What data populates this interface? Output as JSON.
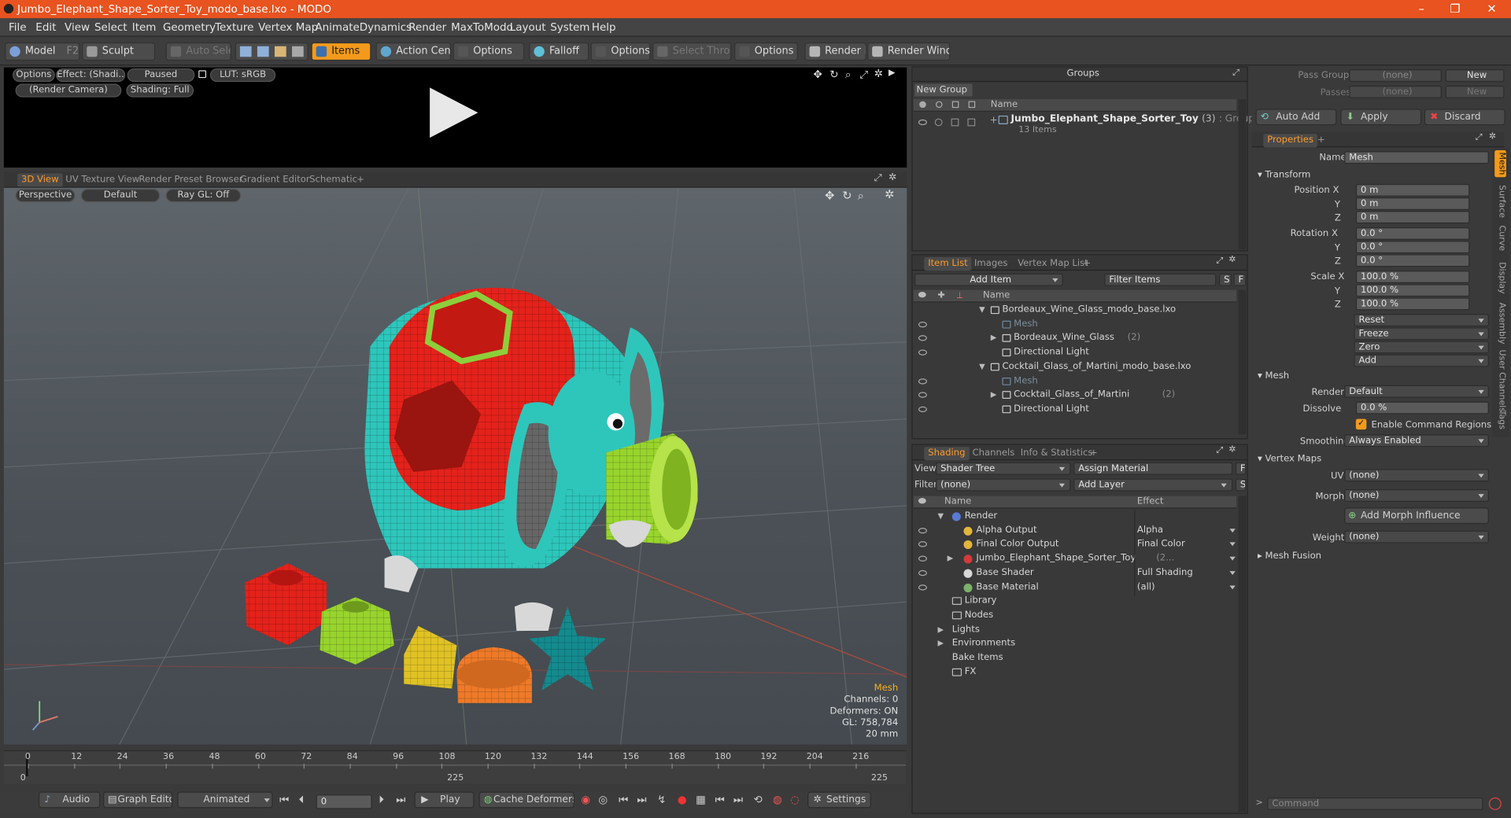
{
  "window": {
    "title": "Jumbo_Elephant_Shape_Sorter_Toy_modo_base.lxo - MODO",
    "controls": [
      "–",
      "❐",
      "✕"
    ]
  },
  "menu": [
    "File",
    "Edit",
    "View",
    "Select",
    "Item",
    "Geometry",
    "Texture",
    "Vertex Map",
    "Animate",
    "Dynamics",
    "Render",
    "MaxToModo",
    "Layout",
    "System",
    "Help"
  ],
  "toolbar": {
    "model": "Model",
    "model_key": "F2",
    "sculpt": "Sculpt",
    "auto_select": "Auto Select",
    "items": "Items",
    "action_center": "Action Center",
    "options1": "Options",
    "falloff": "Falloff",
    "options2": "Options",
    "select_through": "Select Through",
    "options3": "Options",
    "render": "Render",
    "render_key": "F9",
    "render_window": "Render Window"
  },
  "preview": {
    "options": "Options",
    "effect": "Effect: (Shadi...",
    "paused": "Paused",
    "lut": "LUT: sRGB",
    "camera": "(Render Camera)",
    "shading": "Shading: Full"
  },
  "viewport_tabs": [
    "3D View",
    "UV Texture View",
    "Render Preset Browser",
    "Gradient Editor",
    "Schematic",
    "+"
  ],
  "viewport": {
    "perspective": "Perspective",
    "default": "Default",
    "raygl": "Ray GL: Off",
    "info": [
      "Mesh",
      "Channels: 0",
      "Deformers: ON",
      "GL: 758,784",
      "20 mm"
    ]
  },
  "timeline": {
    "ticks": [
      "0",
      "12",
      "24",
      "36",
      "48",
      "60",
      "72",
      "84",
      "96",
      "108",
      "120",
      "132",
      "144",
      "156",
      "168",
      "180",
      "192",
      "204",
      "216"
    ],
    "end": "225",
    "start": "0"
  },
  "bottom": {
    "audio": "Audio",
    "graph_editor": "Graph Editor",
    "animated": "Animated",
    "frame": "0",
    "play": "Play",
    "cache": "Cache Deformers",
    "settings": "Settings"
  },
  "groups": {
    "title": "Groups",
    "new_group": "New Group",
    "col_name": "Name",
    "item": "Jumbo_Elephant_Shape_Sorter_Toy",
    "item_count": "(3)",
    "item_type": ": Group",
    "sub": "13 Items"
  },
  "itemlist": {
    "tabs": [
      "Item List",
      "Images",
      "Vertex Map List",
      "+"
    ],
    "add_item": "Add Item",
    "filter": "Filter Items",
    "s": "S",
    "f": "F",
    "col_name": "Name",
    "rows": [
      {
        "label": "Bordeaux_Wine_Glass_modo_base.lxo",
        "indent": 0
      },
      {
        "label": "Mesh",
        "indent": 1,
        "dim": true
      },
      {
        "label": "Bordeaux_Wine_Glass",
        "suffix": "(2)",
        "indent": 1
      },
      {
        "label": "Directional Light",
        "indent": 1
      },
      {
        "label": "Cocktail_Glass_of_Martini_modo_base.lxo",
        "indent": 0
      },
      {
        "label": "Mesh",
        "indent": 1,
        "dim": true
      },
      {
        "label": "Cocktail_Glass_of_Martini",
        "suffix": "(2)",
        "indent": 1
      },
      {
        "label": "Directional Light",
        "indent": 1
      }
    ]
  },
  "shading": {
    "tabs": [
      "Shading",
      "Channels",
      "Info & Statistics",
      "+"
    ],
    "view_label": "View",
    "view": "Shader Tree",
    "assign": "Assign Material",
    "filter_label": "Filter",
    "filter": "(none)",
    "add_layer": "Add Layer",
    "col_name": "Name",
    "col_effect": "Effect",
    "rows": [
      {
        "label": "Render",
        "effect": "",
        "indent": 0
      },
      {
        "label": "Alpha Output",
        "effect": "Alpha",
        "indent": 1
      },
      {
        "label": "Final Color Output",
        "effect": "Final Color",
        "indent": 1
      },
      {
        "label": "Jumbo_Elephant_Shape_Sorter_Toy",
        "suffix": "(2...",
        "effect": "",
        "indent": 1
      },
      {
        "label": "Base Shader",
        "effect": "Full Shading",
        "indent": 1
      },
      {
        "label": "Base Material",
        "effect": "(all)",
        "indent": 1
      },
      {
        "label": "Library",
        "effect": "",
        "indent": 0
      },
      {
        "label": "Nodes",
        "effect": "",
        "indent": 0
      },
      {
        "label": "Lights",
        "effect": "",
        "indent": 0
      },
      {
        "label": "Environments",
        "effect": "",
        "indent": 0
      },
      {
        "label": "Bake Items",
        "effect": "",
        "indent": 0
      },
      {
        "label": "FX",
        "effect": "",
        "indent": 0
      }
    ]
  },
  "props": {
    "pass_groups": "Pass Groups",
    "passes": "Passes",
    "none": "(none)",
    "new": "New",
    "auto_add": "Auto Add",
    "apply": "Apply",
    "discard": "Discard",
    "tab": "Properties",
    "name_label": "Name",
    "name": "Mesh",
    "transform": "Transform",
    "position_label": "Position X",
    "rotation_label": "Rotation X",
    "scale_label": "Scale X",
    "y": "Y",
    "z": "Z",
    "pos": [
      "0 m",
      "0 m",
      "0 m"
    ],
    "rot": [
      "0.0 °",
      "0.0 °",
      "0.0 °"
    ],
    "scale": [
      "100.0 %",
      "100.0 %",
      "100.0 %"
    ],
    "reset": "Reset",
    "freeze": "Freeze",
    "zero": "Zero",
    "add": "Add",
    "mesh": "Mesh",
    "render_label": "Render",
    "render": "Default",
    "dissolve_label": "Dissolve",
    "dissolve": "0.0 %",
    "enable_cmd": "Enable Command Regions",
    "smoothing_label": "Smoothing",
    "smoothing": "Always Enabled",
    "vertex_maps": "Vertex Maps",
    "uv_label": "UV",
    "uv": "(none)",
    "morph_label": "Morph",
    "morph": "(none)",
    "add_morph": "Add Morph Influence",
    "weight_label": "Weight",
    "weight": "(none)",
    "mesh_fusion": "Mesh Fusion",
    "command": "Command",
    "side_tabs": [
      "Mesh",
      "Surface",
      "Curve",
      "Display",
      "Assembly",
      "User Channels",
      "Tags"
    ]
  }
}
